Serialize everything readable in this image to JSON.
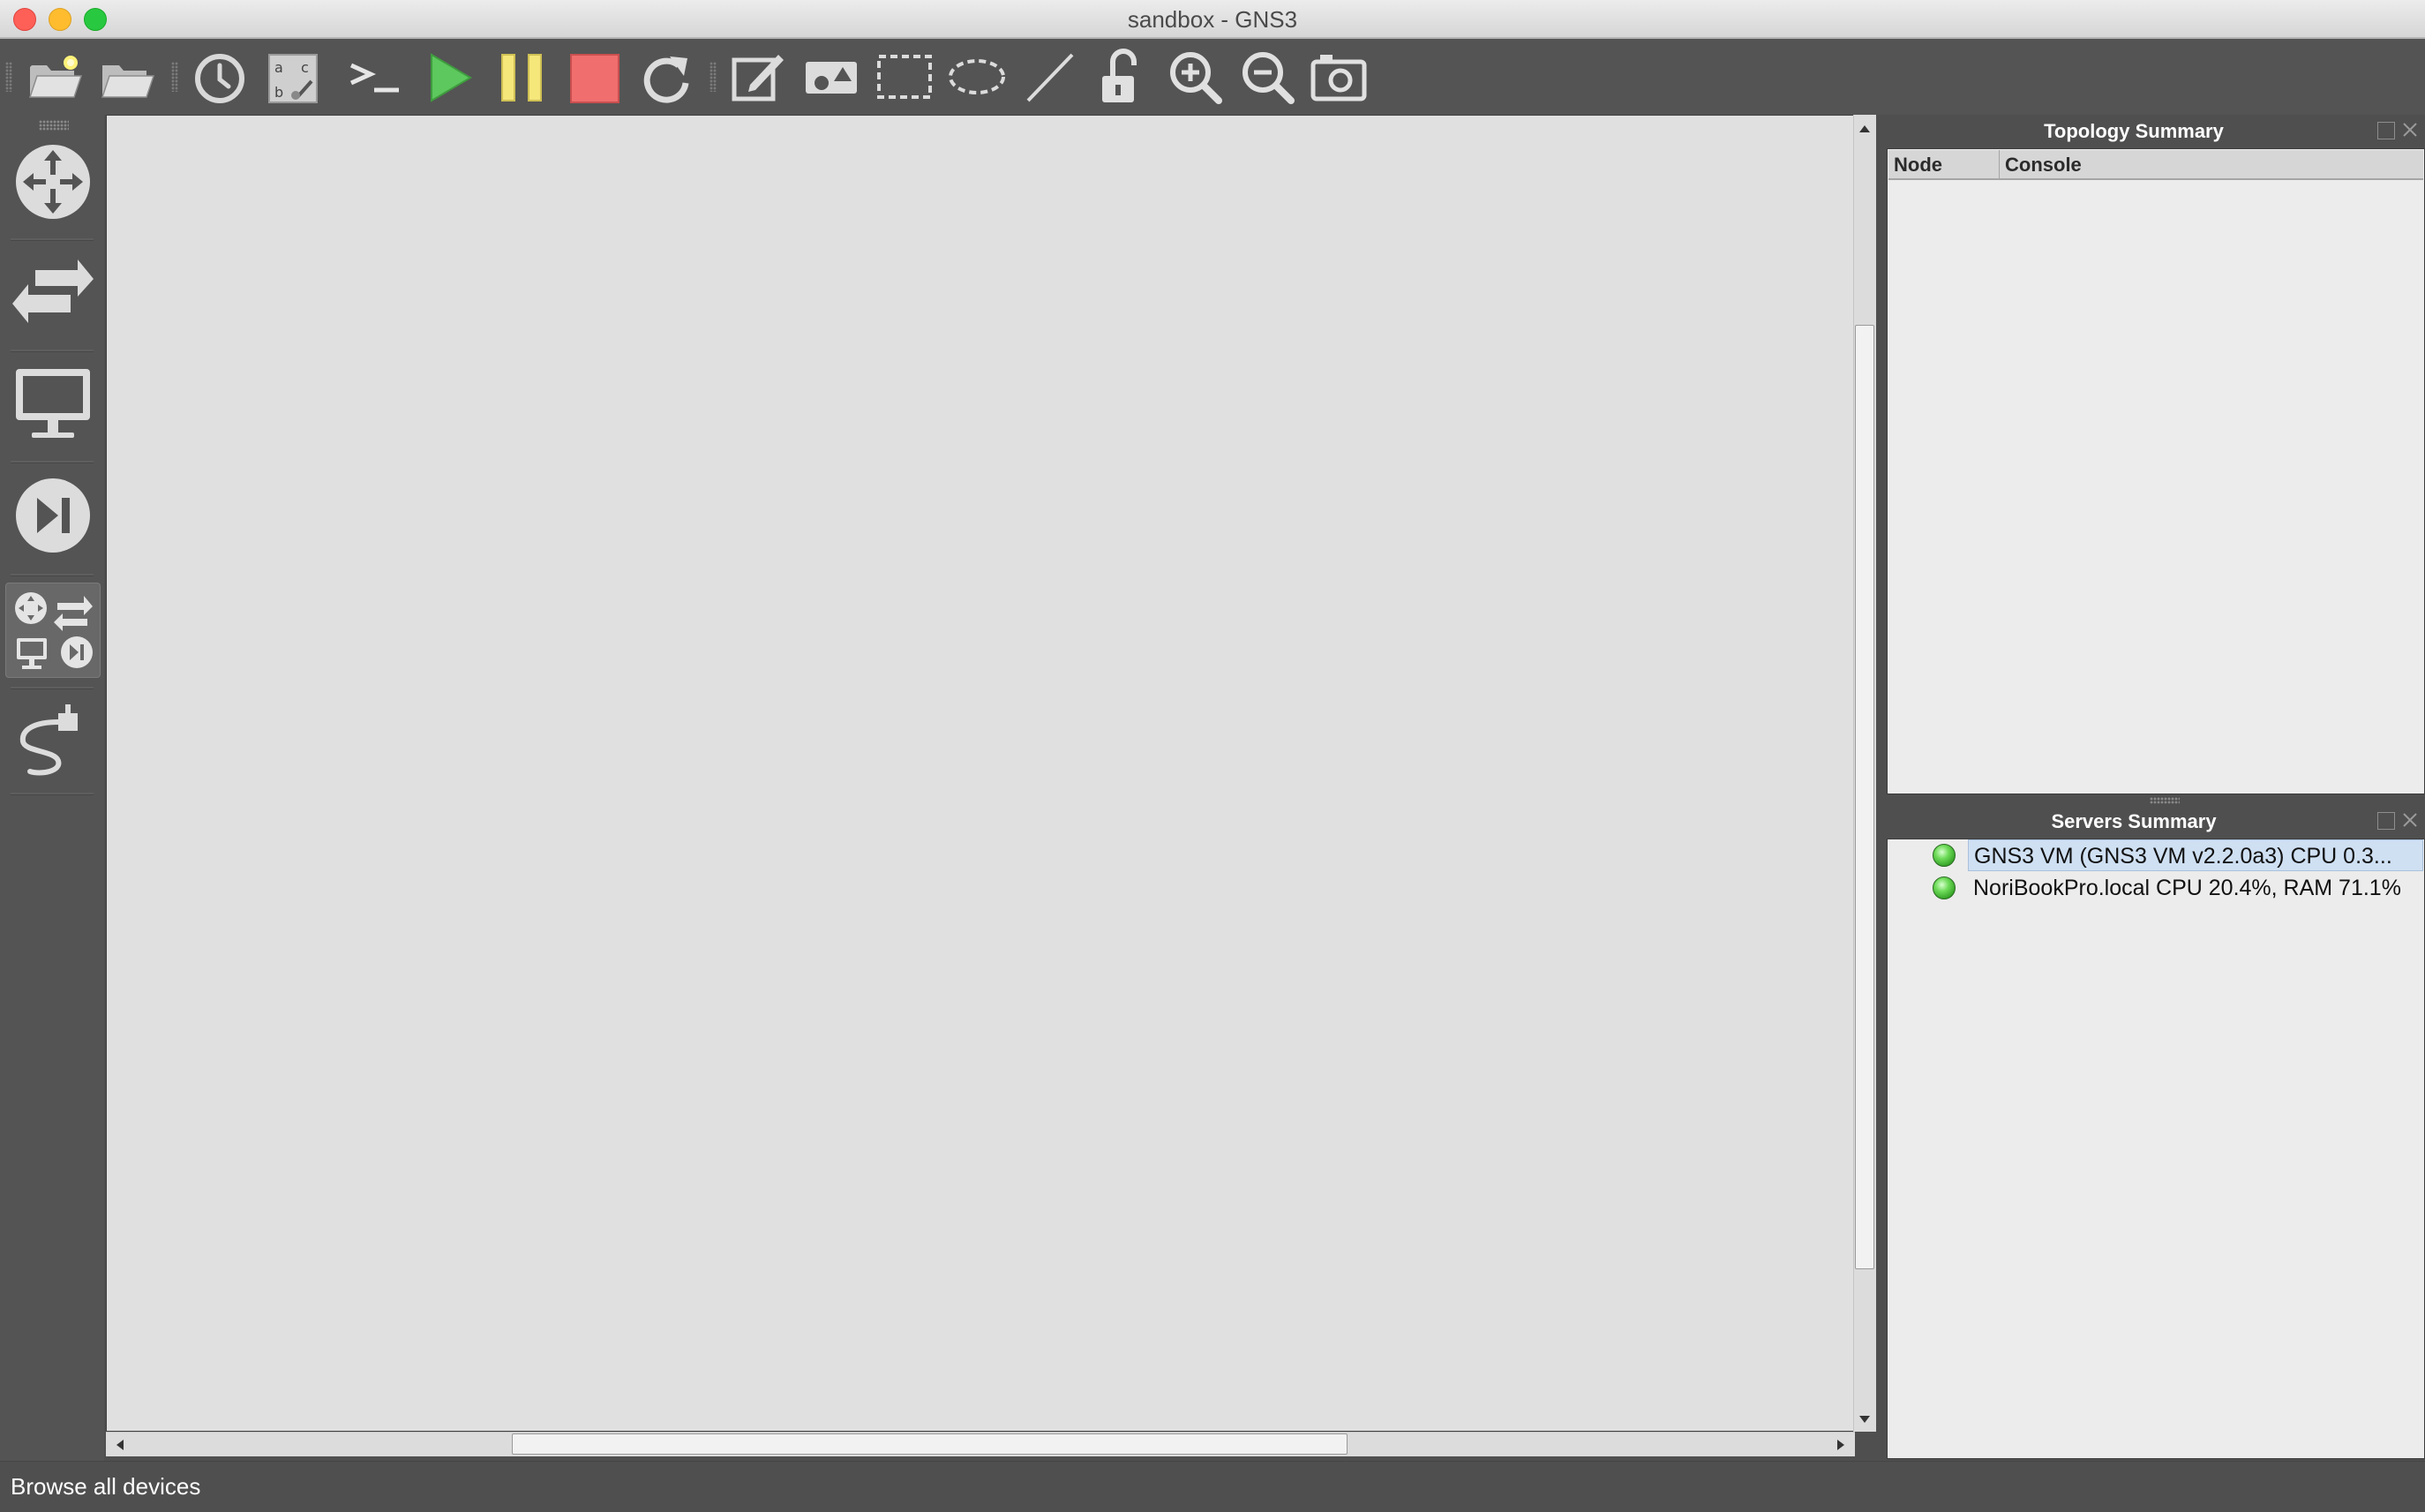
{
  "window": {
    "title": "sandbox - GNS3",
    "controls": [
      "close",
      "minimize",
      "zoom"
    ]
  },
  "toolbar": {
    "buttons": [
      {
        "name": "new-project",
        "icon": "folder-new-icon"
      },
      {
        "name": "open-project",
        "icon": "folder-open-icon"
      },
      {
        "name": "snapshots",
        "icon": "clock-icon"
      },
      {
        "name": "show-interface-labels",
        "icon": "abc-labels-icon"
      },
      {
        "name": "console-all",
        "icon": "terminal-icon",
        "label": ">_"
      },
      {
        "name": "start-all",
        "icon": "play-icon",
        "color": "#5dc85d"
      },
      {
        "name": "suspend-all",
        "icon": "pause-icon",
        "color": "#f5e77a"
      },
      {
        "name": "stop-all",
        "icon": "stop-icon",
        "color": "#f06e6e"
      },
      {
        "name": "reload-all",
        "icon": "reload-icon"
      },
      {
        "name": "add-note",
        "icon": "edit-note-icon"
      },
      {
        "name": "insert-image",
        "icon": "insert-image-icon"
      },
      {
        "name": "draw-rectangle",
        "icon": "rectangle-icon"
      },
      {
        "name": "draw-ellipse",
        "icon": "ellipse-icon"
      },
      {
        "name": "draw-line",
        "icon": "line-icon"
      },
      {
        "name": "lock-items",
        "icon": "unlock-icon"
      },
      {
        "name": "zoom-in",
        "icon": "zoom-in-icon"
      },
      {
        "name": "zoom-out",
        "icon": "zoom-out-icon"
      },
      {
        "name": "screenshot",
        "icon": "camera-icon"
      }
    ]
  },
  "device_dock": {
    "buttons": [
      {
        "name": "routers",
        "icon": "router-icon"
      },
      {
        "name": "switches",
        "icon": "switch-icon"
      },
      {
        "name": "end-devices",
        "icon": "monitor-icon"
      },
      {
        "name": "security-devices",
        "icon": "play-skip-icon"
      },
      {
        "name": "all-devices",
        "icon": "all-devices-icon",
        "active": true
      },
      {
        "name": "add-link",
        "icon": "cable-icon"
      }
    ]
  },
  "topology_summary": {
    "title": "Topology Summary",
    "columns": [
      "Node",
      "Console"
    ],
    "rows": []
  },
  "servers_summary": {
    "title": "Servers Summary",
    "servers": [
      {
        "label": "GNS3 VM (GNS3 VM v2.2.0a3) CPU 0.3...",
        "status": "running",
        "selected": true
      },
      {
        "label": "NoriBookPro.local CPU 20.4%, RAM 71.1%",
        "status": "running",
        "selected": false
      }
    ]
  },
  "statusbar": {
    "message": "Browse all devices"
  },
  "colors": {
    "chrome": "#545454",
    "canvas": "#e0e0e0",
    "panel": "#ececec",
    "selection": "#cfe0f3",
    "status_led": "#4caf3c"
  }
}
